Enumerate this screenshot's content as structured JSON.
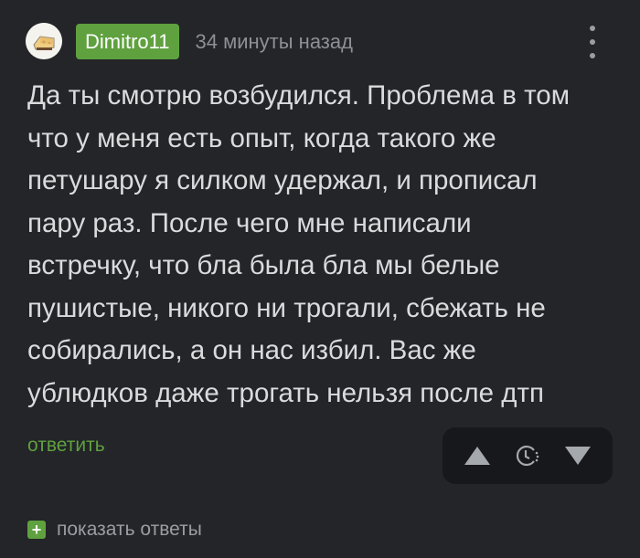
{
  "comment": {
    "author": "Dimitro11",
    "time_ago": "34 минуты назад",
    "text": "Да ты смотрю возбудился. Проблема в том\nчто у меня есть опыт, когда такого же\nпетушару я силком удержал, и прописал\nпару раз. После чего мне написали\nвстречку, что бла была бла мы белые\nпушистые, никого ни трогали, сбежать не\nсобирались, а он нас избил. Вас же\nублюдков даже трогать нельзя после дтп",
    "reply_label": "ответить",
    "show_replies_label": "показать ответы",
    "plus_symbol": "+"
  },
  "icons": {
    "menu": "more-vertical-icon",
    "upvote": "triangle-up-icon",
    "timer": "clock-icon",
    "downvote": "triangle-down-icon"
  },
  "colors": {
    "background": "#232528",
    "accent_green": "#5fa13f",
    "muted_text": "#8d9094",
    "vote_box": "#17181b"
  }
}
